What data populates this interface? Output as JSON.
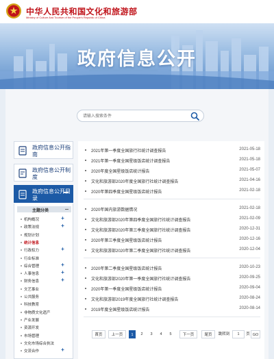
{
  "header": {
    "ministry_cn": "中华人民共和国文化和旅游部",
    "ministry_en": "Ministry of Culture And Tourism of the People's Republic of China",
    "banner_title": "政府信息公开"
  },
  "search": {
    "placeholder": "请输入搜索条件"
  },
  "sidebar": {
    "tabs": [
      {
        "label": "政府信息公开指南"
      },
      {
        "label": "政府信息公开制度"
      },
      {
        "label": "政府信息公开目录"
      }
    ],
    "topic_header": "主题分类",
    "topics": [
      {
        "label": "机构概况",
        "expand": true
      },
      {
        "label": "政策法规",
        "expand": true
      },
      {
        "label": "规划计划",
        "expand": false
      },
      {
        "label": "统计信息",
        "expand": false,
        "current": true
      },
      {
        "label": "行政权力",
        "expand": true
      },
      {
        "label": "行业标准",
        "expand": false
      },
      {
        "label": "综合管理",
        "expand": true
      },
      {
        "label": "人事信息",
        "expand": true
      },
      {
        "label": "财务信息",
        "expand": true
      },
      {
        "label": "文艺事业",
        "expand": false
      },
      {
        "label": "公共服务",
        "expand": false
      },
      {
        "label": "科技教育",
        "expand": false
      },
      {
        "label": "非物质文化遗产",
        "expand": false
      },
      {
        "label": "产业发展",
        "expand": false
      },
      {
        "label": "资源开发",
        "expand": false
      },
      {
        "label": "市场管理",
        "expand": false
      },
      {
        "label": "文化市场综合执法",
        "expand": false
      },
      {
        "label": "交流合作",
        "expand": true
      }
    ]
  },
  "list_groups": [
    [
      {
        "title": "2021年第一季度全国旅行社统计调查报告",
        "date": "2021-05-18"
      },
      {
        "title": "2021年第一季度全国星级饭店统计调查报告",
        "date": "2021-05-18"
      },
      {
        "title": "2020年度全国星级饭店统计报告",
        "date": "2021-05-07"
      },
      {
        "title": "文化和旅游部2020年度全国旅行社统计调查报告",
        "date": "2021-04-16"
      },
      {
        "title": "2020年第四季度全国星级饭店统计报告",
        "date": "2021-02-18"
      }
    ],
    [
      {
        "title": "2020年国内旅游数据情况",
        "date": "2021-02-18"
      },
      {
        "title": "文化和旅游部2020年第四季度全国旅行社统计调查报告",
        "date": "2021-02-09"
      },
      {
        "title": "文化和旅游部2020年第三季度全国旅行社统计调查报告",
        "date": "2020-12-31"
      },
      {
        "title": "2020年第三季度全国星级饭店统计报告",
        "date": "2020-12-16"
      },
      {
        "title": "文化和旅游部2020年第二季度全国旅行社统计调查报告",
        "date": "2020-12-04"
      }
    ],
    [
      {
        "title": "2020年第二季度全国星级饭店统计报告",
        "date": "2020-10-23"
      },
      {
        "title": "文化和旅游部2020年第一季度全国旅行社统计调查报告",
        "date": "2020-09-25"
      },
      {
        "title": "2020年第一季度全国星级饭店统计报告",
        "date": "2020-09-04"
      },
      {
        "title": "文化和旅游部2019年度全国旅行社统计调查报告",
        "date": "2020-08-24"
      },
      {
        "title": "2019年度全国星级饭店统计报告",
        "date": "2020-08-14"
      }
    ]
  ],
  "pager": {
    "first": "首页",
    "prev": "上一页",
    "pages": [
      "1",
      "2",
      "3",
      "4",
      "5"
    ],
    "current": "1",
    "next": "下一页",
    "last": "尾页",
    "jump_to": "跳转到",
    "jump_value": "1",
    "page_unit": "页",
    "go": "GO"
  }
}
